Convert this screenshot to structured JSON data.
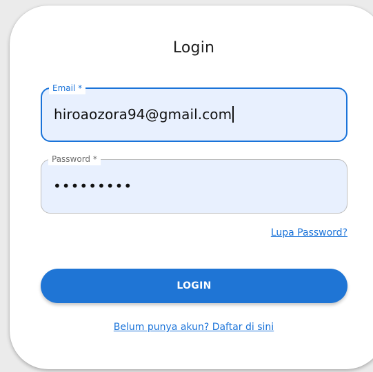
{
  "form": {
    "title": "Login",
    "email": {
      "label": "Email *",
      "value": "hiroaozora94@gmail.com"
    },
    "password": {
      "label": "Password *",
      "masked_value": "•••••••••"
    },
    "forgot_link": "Lupa Password?",
    "login_button": "LOGIN",
    "register_link": "Belum punya akun? Daftar di sini"
  },
  "colors": {
    "accent": "#1a73d9",
    "button": "#1f75d5",
    "input_bg": "#e8f0fe"
  }
}
